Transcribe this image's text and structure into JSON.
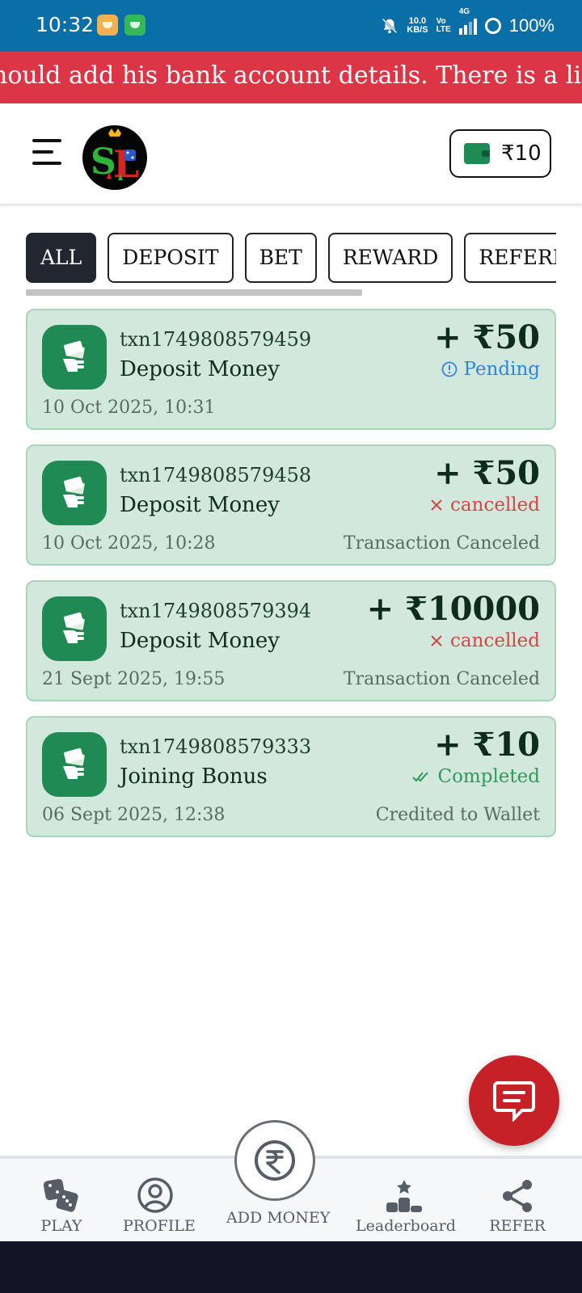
{
  "status_bar": {
    "time": "10:32",
    "net_speed_value": "10.0",
    "net_speed_unit": "KB/S",
    "volte_top": "Vo",
    "volte_bottom": "LTE",
    "network": "4G",
    "battery": "100%"
  },
  "announcement": {
    "text": "hould add his bank account details. There is a limit"
  },
  "header": {
    "menu_icon": "hamburger-menu-icon",
    "logo_text": "SL",
    "wallet_icon": "wallet-icon",
    "wallet_balance": "₹10"
  },
  "tabs": [
    {
      "label": "ALL",
      "active": true
    },
    {
      "label": "DEPOSIT",
      "active": false
    },
    {
      "label": "BET",
      "active": false
    },
    {
      "label": "REWARD",
      "active": false
    },
    {
      "label": "REFERRAL",
      "active": false
    }
  ],
  "transactions": [
    {
      "id": "txn1749808579459",
      "title": "Deposit Money",
      "date": "10 Oct 2025, 10:31",
      "amount": "+ ₹50",
      "status": "Pending",
      "status_type": "pending",
      "note": ""
    },
    {
      "id": "txn1749808579458",
      "title": "Deposit Money",
      "date": "10 Oct 2025, 10:28",
      "amount": "+ ₹50",
      "status": "cancelled",
      "status_type": "cancelled",
      "note": "Transaction Canceled"
    },
    {
      "id": "txn1749808579394",
      "title": "Deposit Money",
      "date": "21 Sept 2025, 19:55",
      "amount": "+ ₹10000",
      "status": "cancelled",
      "status_type": "cancelled",
      "note": "Transaction Canceled"
    },
    {
      "id": "txn1749808579333",
      "title": "Joining Bonus",
      "date": "06 Sept 2025, 12:38",
      "amount": "+ ₹10",
      "status": "Completed",
      "status_type": "completed",
      "note": "Credited to Wallet"
    }
  ],
  "bottom_nav": {
    "play": "PLAY",
    "profile": "PROFILE",
    "add_money": "ADD MONEY",
    "leaderboard": "Leaderboard",
    "refer": "REFER"
  },
  "colors": {
    "status_bar": "#0a6ea7",
    "banner": "#dc3545",
    "card_bg": "#d3e8dc",
    "brand_green": "#1f8a53",
    "chat_fab": "#c62127"
  }
}
